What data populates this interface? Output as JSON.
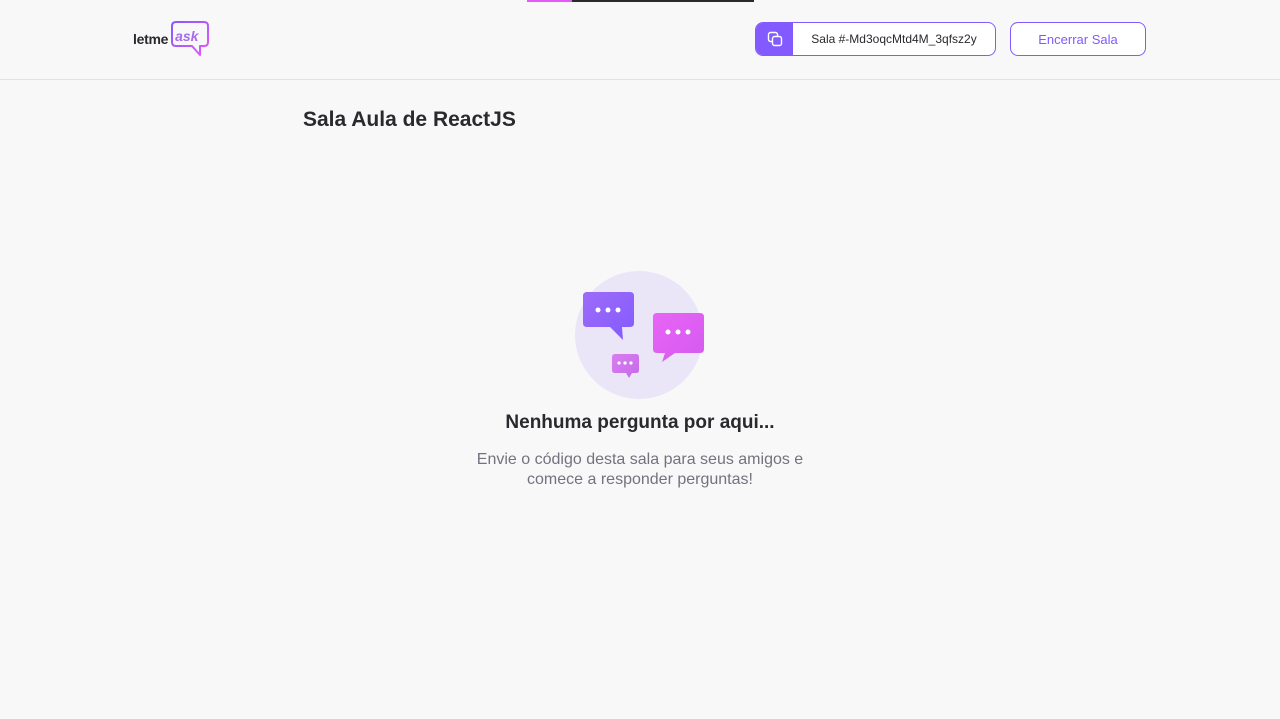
{
  "header": {
    "logo": {
      "prefix": "letme",
      "accent": "ask"
    },
    "room_code": {
      "label": "Sala #-Md3oqcMtd4M_3qfsz2y"
    },
    "close_room_label": "Encerrar Sala"
  },
  "main": {
    "title": "Sala Aula de ReactJS",
    "empty": {
      "title": "Nenhuma pergunta por aqui...",
      "description": "Envie o código desta sala para seus amigos e comece a responder perguntas!"
    }
  },
  "colors": {
    "primary": "#835afd",
    "accent_pink": "#e559f9",
    "background": "#f8f8f8",
    "text": "#29292e",
    "muted": "#737380"
  },
  "icons": {
    "copy": "copy-icon",
    "illustration": "empty-questions-icon"
  }
}
